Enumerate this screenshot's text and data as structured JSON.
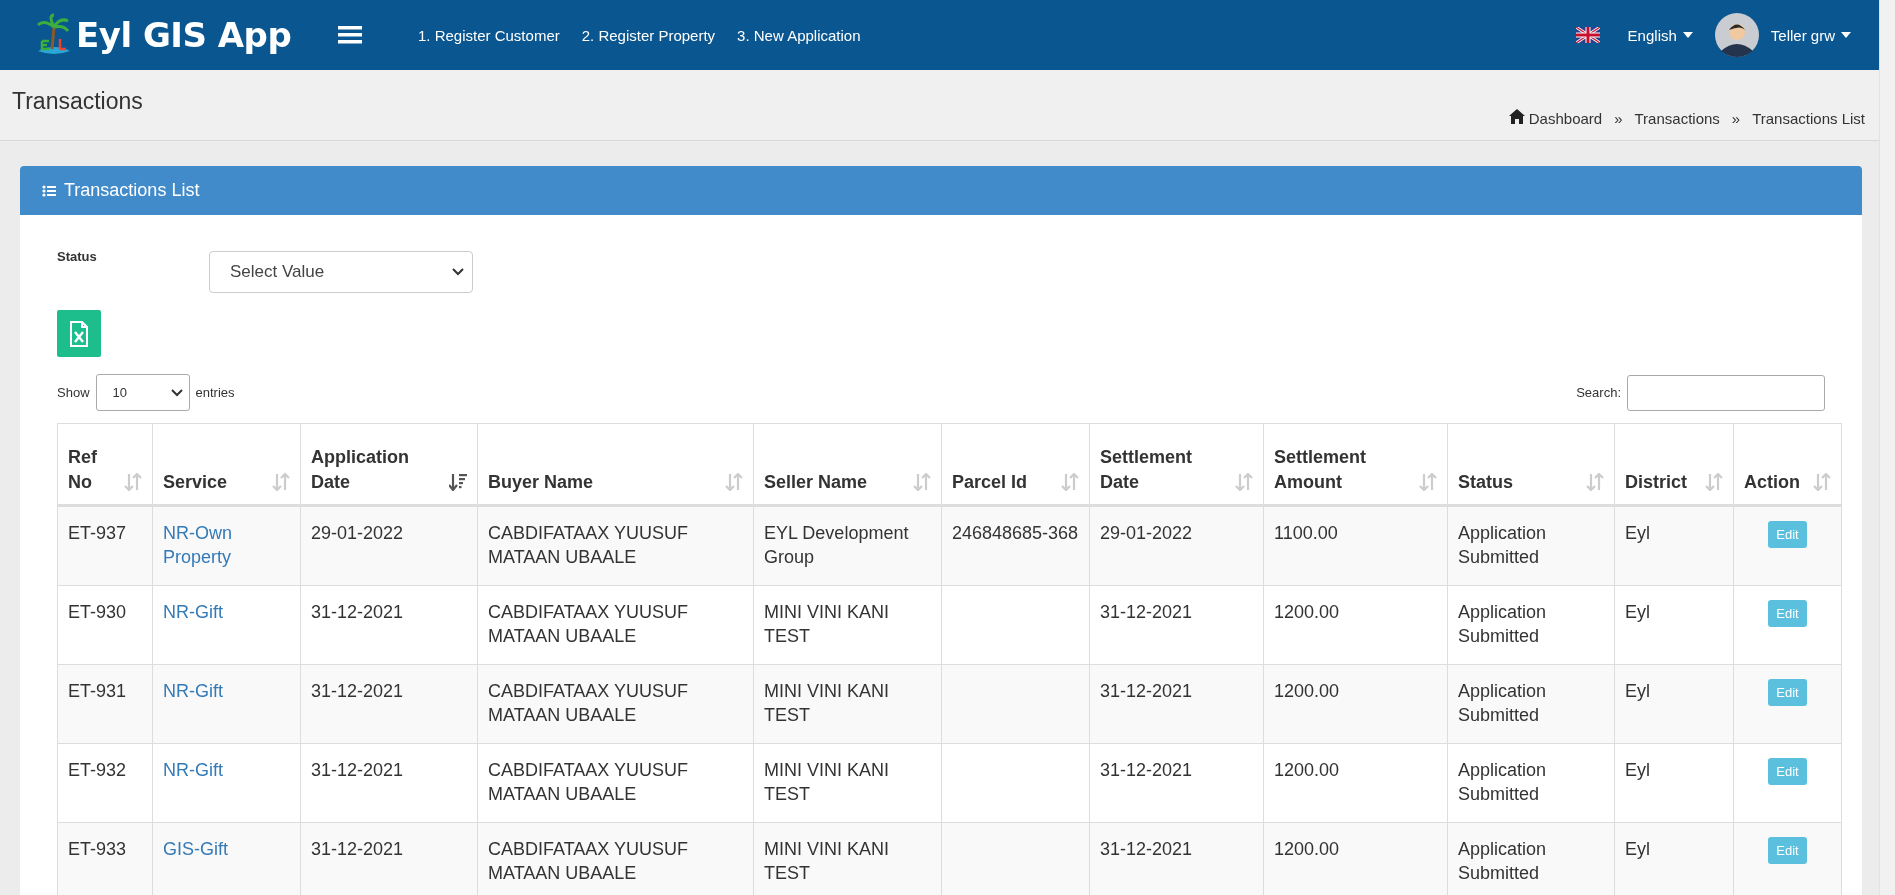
{
  "navbar": {
    "brand": "Eyl GIS App",
    "links": [
      "1. Register Customer",
      "2. Register Property",
      "3. New Application"
    ],
    "language": "English",
    "user": "Teller grw"
  },
  "page": {
    "title": "Transactions",
    "breadcrumb": [
      "Dashboard",
      "Transactions",
      "Transactions List"
    ],
    "separator": "»"
  },
  "panel": {
    "title": "Transactions List",
    "filter": {
      "label": "Status",
      "value": "Select Value"
    },
    "length": {
      "prefix": "Show",
      "value": "10",
      "suffix": "entries"
    },
    "search": {
      "label": "Search:"
    },
    "table": {
      "columns": [
        {
          "label": "Ref No",
          "sorted": false
        },
        {
          "label": "Service",
          "sorted": false
        },
        {
          "label": "Application Date",
          "sorted": true
        },
        {
          "label": "Buyer Name",
          "sorted": false
        },
        {
          "label": "Seller Name",
          "sorted": false
        },
        {
          "label": "Parcel Id",
          "sorted": false
        },
        {
          "label": "Settlement Date",
          "sorted": false
        },
        {
          "label": "Settlement Amount",
          "sorted": false
        },
        {
          "label": "Status",
          "sorted": false
        },
        {
          "label": "District",
          "sorted": false
        },
        {
          "label": "Action",
          "sorted": false
        }
      ],
      "rows": [
        {
          "ref": "ET-937",
          "service": "NR-Own Property",
          "app_date": "29-01-2022",
          "buyer": "CABDIFATAAX YUUSUF MATAAN UBAALE",
          "seller": "EYL Development Group",
          "parcel": "246848685-368",
          "settle_date": "29-01-2022",
          "amount": "1100.00",
          "status": "Application Submitted",
          "district": "Eyl",
          "action": "Edit"
        },
        {
          "ref": "ET-930",
          "service": "NR-Gift",
          "app_date": "31-12-2021",
          "buyer": "CABDIFATAAX YUUSUF MATAAN UBAALE",
          "seller": "MINI VINI KANI TEST",
          "settle_date": "31-12-2021",
          "amount": "1200.00",
          "status": "Application Submitted",
          "district": "Eyl",
          "action": "Edit"
        },
        {
          "ref": "ET-931",
          "service": "NR-Gift",
          "app_date": "31-12-2021",
          "buyer": "CABDIFATAAX YUUSUF MATAAN UBAALE",
          "seller": "MINI VINI KANI TEST",
          "settle_date": "31-12-2021",
          "amount": "1200.00",
          "status": "Application Submitted",
          "district": "Eyl",
          "action": "Edit"
        },
        {
          "ref": "ET-932",
          "service": "NR-Gift",
          "app_date": "31-12-2021",
          "buyer": "CABDIFATAAX YUUSUF MATAAN UBAALE",
          "seller": "MINI VINI KANI TEST",
          "settle_date": "31-12-2021",
          "amount": "1200.00",
          "status": "Application Submitted",
          "district": "Eyl",
          "action": "Edit"
        },
        {
          "ref": "ET-933",
          "service": "GIS-Gift",
          "app_date": "31-12-2021",
          "buyer": "CABDIFATAAX YUUSUF MATAAN UBAALE",
          "seller": "MINI VINI KANI TEST",
          "settle_date": "31-12-2021",
          "amount": "1200.00",
          "status": "Application Submitted",
          "district": "Eyl",
          "action": "Edit"
        }
      ]
    }
  }
}
